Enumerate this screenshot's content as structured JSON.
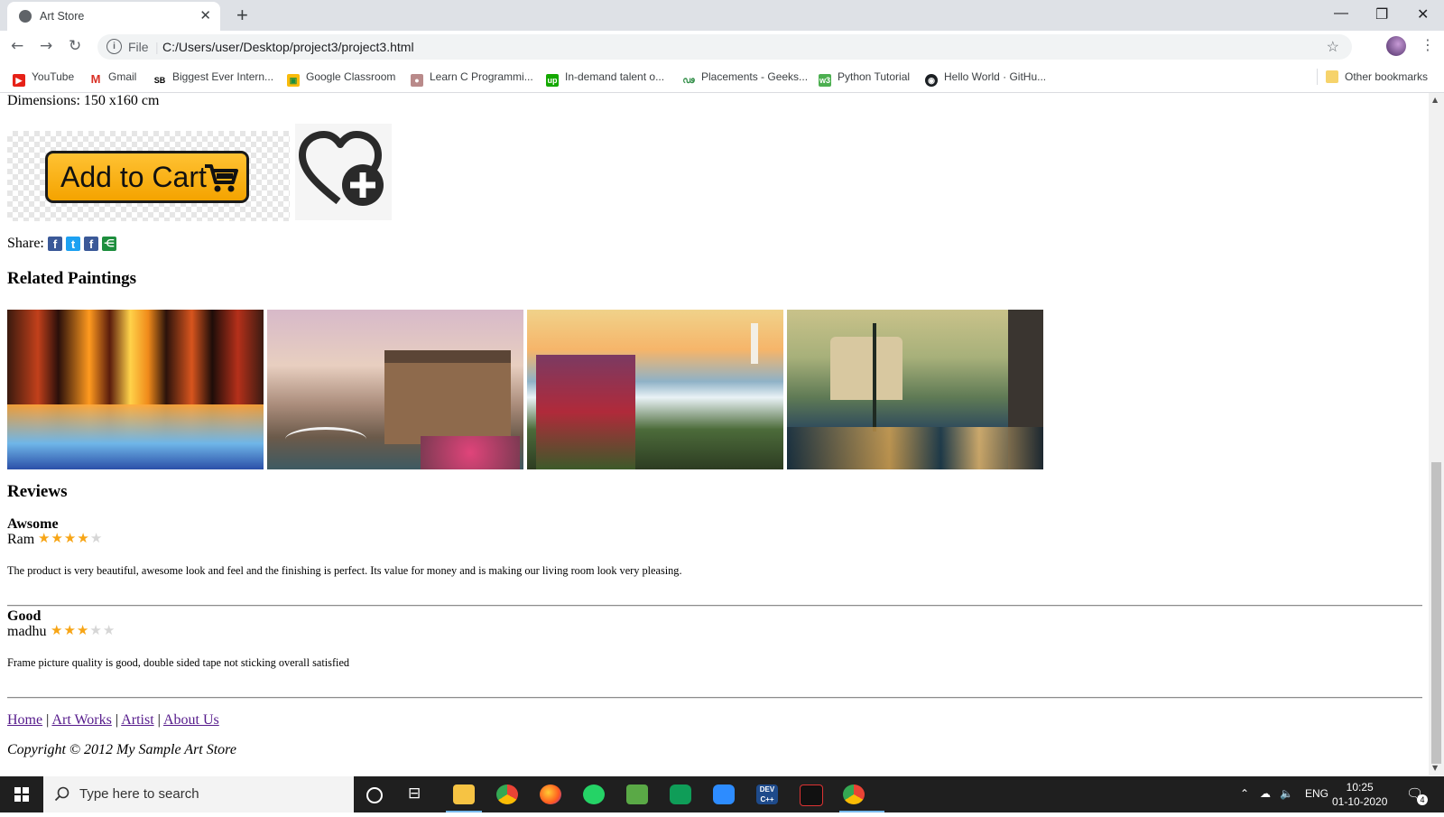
{
  "browser": {
    "tab_title": "Art Store",
    "url_scheme": "File",
    "url": "C:/Users/user/Desktop/project3/project3.html",
    "bookmarks": [
      "YouTube",
      "Gmail",
      "Biggest Ever Intern...",
      "Google Classroom",
      "Learn C Programmi...",
      "In-demand talent o...",
      "Placements - Geeks...",
      "Python Tutorial",
      "Hello World · GitHu..."
    ],
    "other_bookmarks": "Other bookmarks"
  },
  "product": {
    "dimensions": "Dimensions: 150 x160 cm",
    "cart_label": "Add to Cart",
    "share_label": "Share:"
  },
  "related": {
    "heading": "Related Paintings"
  },
  "reviews": {
    "heading": "Reviews",
    "items": [
      {
        "title": "Awsome",
        "author": "Ram",
        "rating": 4,
        "max": 5,
        "text": "The product is very beautiful, awesome look and feel and the finishing is perfect. Its value for money and is making our living room look very pleasing."
      },
      {
        "title": "Good",
        "author": "madhu",
        "rating": 3,
        "max": 5,
        "text": "Frame picture quality is good, double sided tape not sticking overall satisfied"
      }
    ]
  },
  "footer": {
    "links": [
      "Home",
      "Art Works",
      "Artist",
      "About Us"
    ],
    "separator": "|",
    "copyright": "Copyright © 2012 My Sample Art Store"
  },
  "taskbar": {
    "search_placeholder": "Type here to search",
    "language": "ENG",
    "time": "10:25",
    "date": "01-10-2020",
    "notifications": "4"
  },
  "colors": {
    "star_on": "#f7a516",
    "star_off": "#d6d6d6",
    "visited_link": "#551a8b",
    "cart_button": "#f4a300"
  }
}
